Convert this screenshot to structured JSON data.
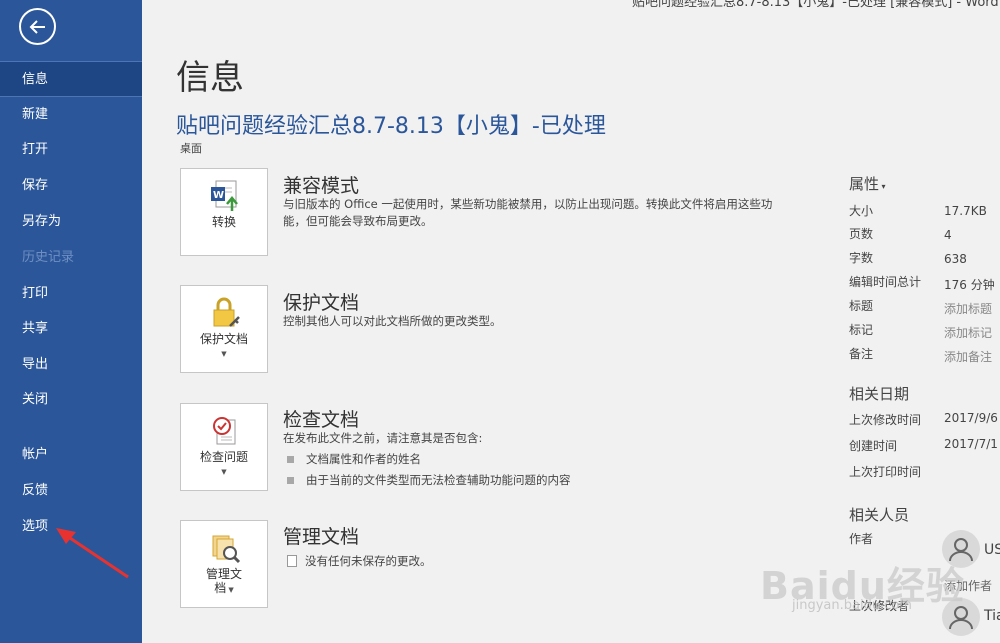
{
  "window_title": "贴吧问题经验汇总8.7-8.13【小鬼】-已处理 [兼容模式] - Word",
  "sidebar": {
    "items": [
      {
        "label": "信息"
      },
      {
        "label": "新建"
      },
      {
        "label": "打开"
      },
      {
        "label": "保存"
      },
      {
        "label": "另存为"
      },
      {
        "label": "历史记录"
      },
      {
        "label": "打印"
      },
      {
        "label": "共享"
      },
      {
        "label": "导出"
      },
      {
        "label": "关闭"
      },
      {
        "label": "帐户"
      },
      {
        "label": "反馈"
      },
      {
        "label": "选项"
      }
    ]
  },
  "main": {
    "title": "信息",
    "doc_title": "贴吧问题经验汇总8.7-8.13【小鬼】-已处理",
    "doc_location": "桌面",
    "sections": [
      {
        "button_label": "转换",
        "title": "兼容模式",
        "description": "与旧版本的 Office 一起使用时，某些新功能被禁用，以防止出现问题。转换此文件将启用这些功能，但可能会导致布局更改。"
      },
      {
        "button_label": "保护文档",
        "title": "保护文档",
        "description": "控制其他人可以对此文档所做的更改类型。"
      },
      {
        "button_label": "检查问题",
        "title": "检查文档",
        "description": "在发布此文件之前，请注意其是否包含:",
        "bullets": [
          "文档属性和作者的姓名",
          "由于当前的文件类型而无法检查辅助功能问题的内容"
        ]
      },
      {
        "button_label_line1": "管理文",
        "button_label_line2": "档",
        "title": "管理文档",
        "description": "没有任何未保存的更改。"
      }
    ]
  },
  "properties": {
    "heading": "属性",
    "rows": [
      {
        "label": "大小",
        "value": "17.7KB"
      },
      {
        "label": "页数",
        "value": "4"
      },
      {
        "label": "字数",
        "value": "638"
      },
      {
        "label": "编辑时间总计",
        "value": "176 分钟"
      },
      {
        "label": "标题",
        "value": "添加标题"
      },
      {
        "label": "标记",
        "value": "添加标记"
      },
      {
        "label": "备注",
        "value": "添加备注"
      }
    ],
    "dates_heading": "相关日期",
    "dates": [
      {
        "label": "上次修改时间",
        "value": "2017/9/6"
      },
      {
        "label": "创建时间",
        "value": "2017/7/1"
      },
      {
        "label": "上次打印时间",
        "value": ""
      }
    ],
    "people_heading": "相关人员",
    "author_label": "作者",
    "author_name": "US",
    "add_author": "添加作者",
    "last_modified_by_label": "上次修改者",
    "last_modified_by_name": "Tia"
  },
  "watermark": {
    "text": "Baidu经验",
    "sub": "jingyan.baidu.com"
  },
  "colors": {
    "sidebar": "#2b579a",
    "accent": "#2b579a",
    "background": "#f1f1f1",
    "annotation_arrow": "#e8322f"
  }
}
